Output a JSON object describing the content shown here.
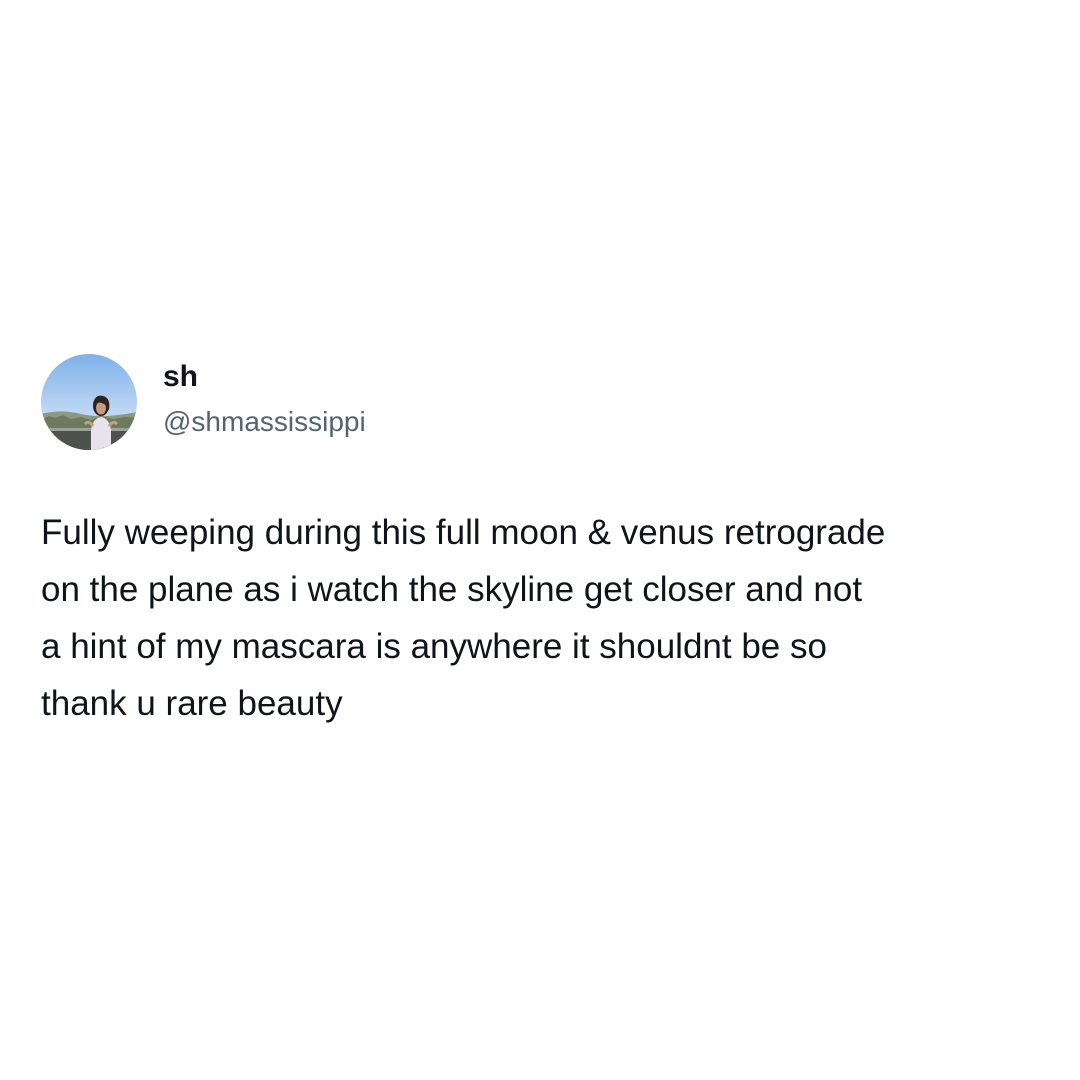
{
  "tweet": {
    "display_name": "sh",
    "handle": "@shmassissippi",
    "avatar_icon": "profile-photo-avatar",
    "body_lines": [
      "Fully weeping during this full moon & venus retrograde",
      "on the plane as i watch the skyline get closer and not",
      "a hint of my mascara is anywhere it shouldnt be so",
      "thank u rare beauty"
    ]
  },
  "colors": {
    "background": "#ffffff",
    "text_primary": "#0f1419",
    "text_secondary": "#536471"
  }
}
